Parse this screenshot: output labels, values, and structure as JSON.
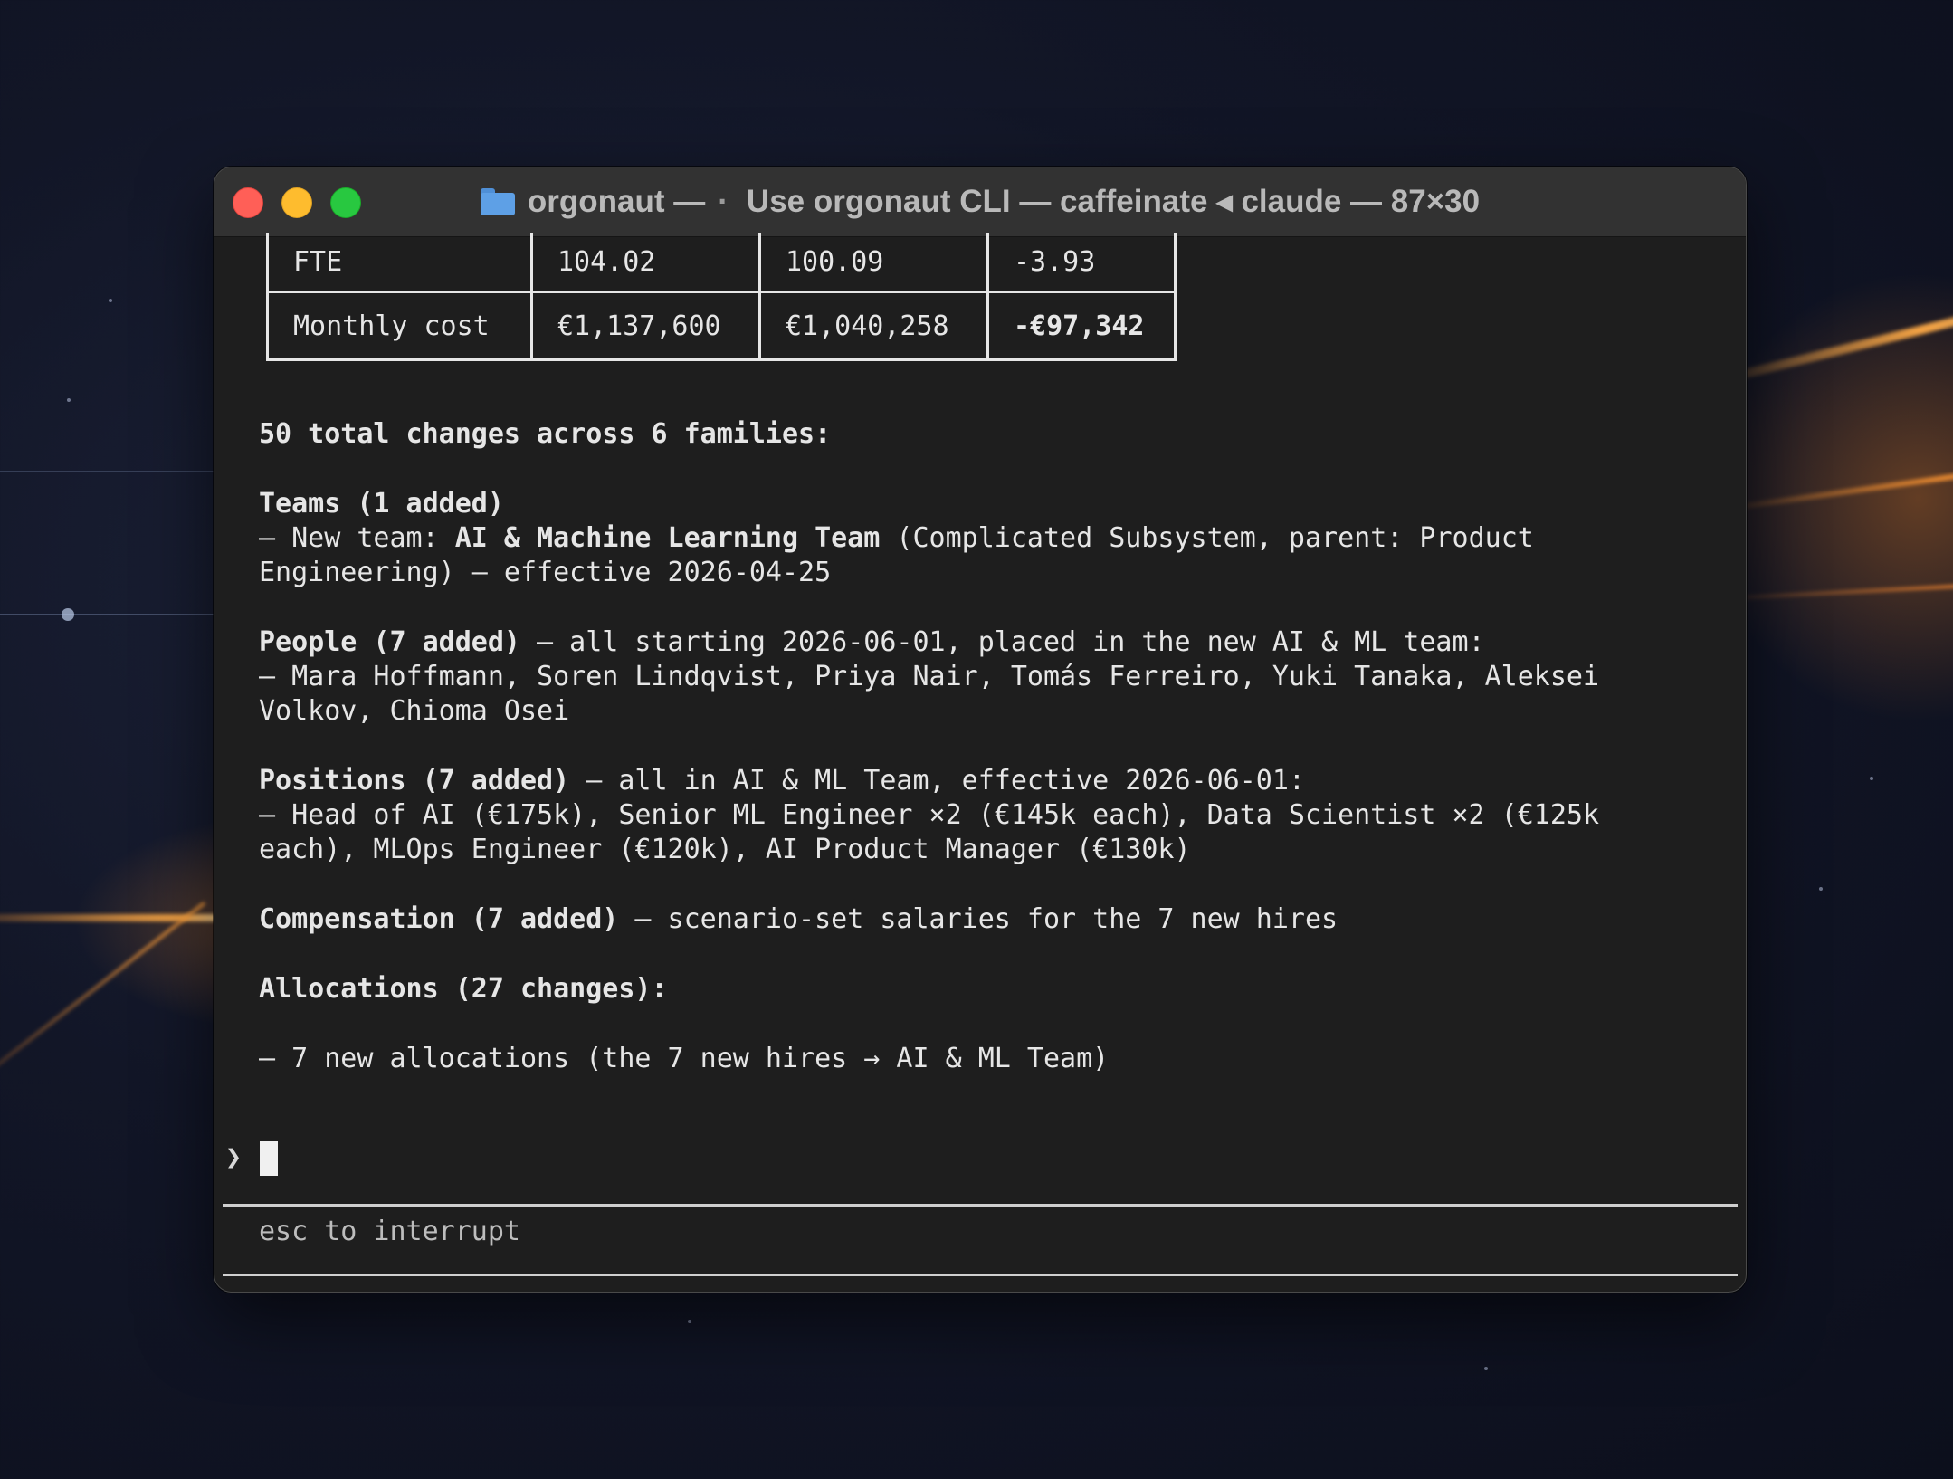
{
  "window": {
    "title_dir": "orgonaut —",
    "title_dot": "·",
    "title_rest": "Use orgonaut CLI — caffeinate ◂ claude — 87×30",
    "folder_icon": "folder-icon"
  },
  "table": {
    "rows": [
      {
        "label": "FTE",
        "before": "104.02",
        "after": "100.09",
        "delta": "-3.93"
      },
      {
        "label": "Monthly cost",
        "before": "€1,137,600",
        "after": "€1,040,258",
        "delta": "-€97,342"
      }
    ]
  },
  "summary": {
    "heading": "50 total changes across 6 families:",
    "teams": {
      "heading": "Teams (1 added)",
      "line1_prefix": "– New team: ",
      "line1_bold": "AI & Machine Learning Team",
      "line1_suffix": " (Complicated Subsystem, parent: Product",
      "line2": "Engineering) — effective 2026-04-25"
    },
    "people": {
      "heading": "People (7 added)",
      "heading_rest": " — all starting 2026-06-01, placed in the new AI & ML team:",
      "line1": "– Mara Hoffmann, Soren Lindqvist, Priya Nair, Tomás Ferreiro, Yuki Tanaka, Aleksei",
      "line2": "Volkov, Chioma Osei"
    },
    "positions": {
      "heading": "Positions (7 added)",
      "heading_rest": " — all in AI & ML Team, effective 2026-06-01:",
      "line1": "– Head of AI (€175k), Senior ML Engineer ×2 (€145k each), Data Scientist ×2 (€125k",
      "line2": "each), MLOps Engineer (€120k), AI Product Manager (€130k)"
    },
    "compensation": {
      "heading": "Compensation (7 added)",
      "heading_rest": " — scenario-set salaries for the 7 new hires"
    },
    "allocations": {
      "heading": "Allocations (27 changes):",
      "line1": "– 7 new allocations (the 7 new hires → AI & ML Team)"
    }
  },
  "prompt": {
    "caret": "❯",
    "hint": "esc to interrupt"
  },
  "colors": {
    "terminal_bg": "#1e1e1e",
    "titlebar_bg": "#323232",
    "text": "#e6e6e6",
    "close": "#ff5f57",
    "minimize": "#febc2e",
    "maximize": "#28c840"
  }
}
